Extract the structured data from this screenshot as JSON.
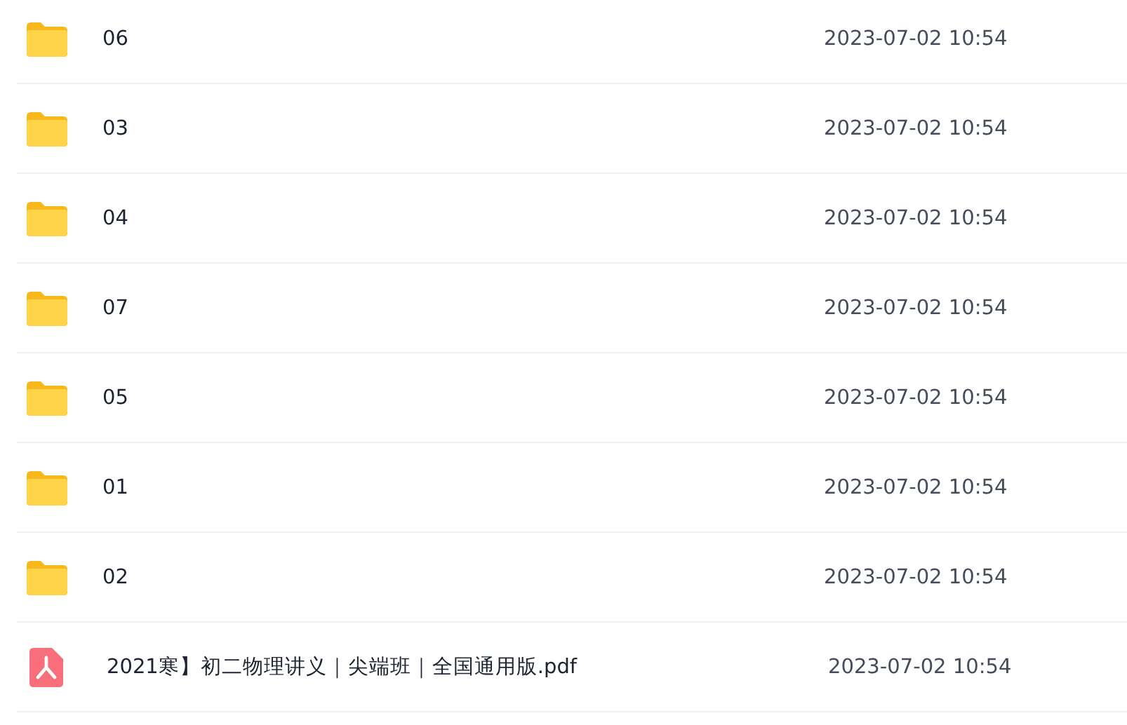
{
  "files": [
    {
      "kind": "folder",
      "name": "06",
      "modified": "2023-07-02 10:54"
    },
    {
      "kind": "folder",
      "name": "03",
      "modified": "2023-07-02 10:54"
    },
    {
      "kind": "folder",
      "name": "04",
      "modified": "2023-07-02 10:54"
    },
    {
      "kind": "folder",
      "name": "07",
      "modified": "2023-07-02 10:54"
    },
    {
      "kind": "folder",
      "name": "05",
      "modified": "2023-07-02 10:54"
    },
    {
      "kind": "folder",
      "name": "01",
      "modified": "2023-07-02 10:54"
    },
    {
      "kind": "folder",
      "name": "02",
      "modified": "2023-07-02 10:54"
    },
    {
      "kind": "pdf",
      "name": "2021寒】初二物理讲义｜尖端班｜全国通用版.pdf",
      "modified": "2023-07-02 10:54"
    }
  ]
}
